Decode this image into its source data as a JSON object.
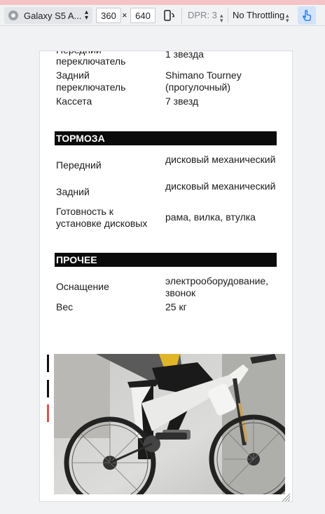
{
  "toolbar": {
    "device": "Galaxy S5 A...",
    "width": "360",
    "height": "640",
    "times": "×",
    "dpr": "DPR: 3",
    "throttling": "No Throttling"
  },
  "specs": {
    "partial_row": {
      "key": "переключатель",
      "value": "1 звезда"
    },
    "transmission": [
      {
        "key": "Задний переключатель",
        "value": "Shimano Tourney (прогулочный)"
      },
      {
        "key": "Кассета",
        "value": "7 звезд"
      }
    ],
    "brakes_title": "ТОРМОЗА",
    "brakes": [
      {
        "key": "Передний",
        "value": "дисковый механический"
      },
      {
        "key": "Задний",
        "value": "дисковый механический"
      },
      {
        "key": "Готовность к установке дисковых",
        "value": "рама, вилка, втулка"
      }
    ],
    "other_title": "ПРОЧЕЕ",
    "other": [
      {
        "key": "Оснащение",
        "value": "электрооборудование, звонок"
      },
      {
        "key": "Вес",
        "value": "25 кг"
      }
    ]
  },
  "colors": {
    "section_bg": "#0b0b0b",
    "accent_red": "#d9534f",
    "touch_active": "#d2e3fc"
  },
  "icons": [
    "chrome-icon",
    "rotate-icon",
    "touch-icon",
    "resize-handle-icon"
  ]
}
